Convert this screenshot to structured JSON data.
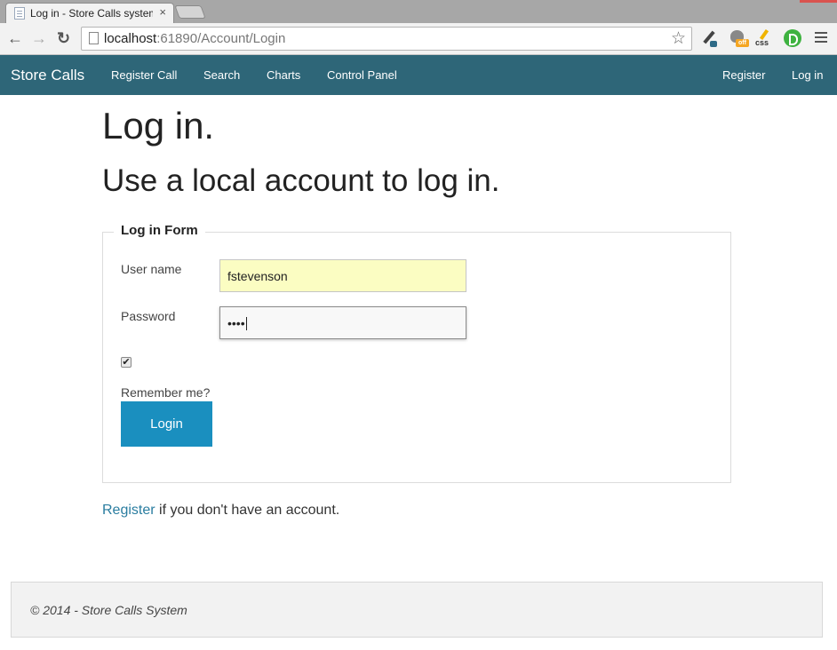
{
  "browser": {
    "tab_title": "Log in - Store Calls system",
    "tab_close": "×",
    "url_host": "localhost",
    "url_rest": ":61890/Account/Login",
    "back": "←",
    "forward": "→",
    "reload": "↻",
    "star": "☆",
    "ext_off_badge": "off",
    "ext_css_label": "css",
    "extensions": [
      "eyedropper-icon",
      "off-cat-icon",
      "css-pencil-icon",
      "ghostery-icon"
    ]
  },
  "navbar": {
    "brand": "Store Calls",
    "links": [
      "Register Call",
      "Search",
      "Charts",
      "Control Panel"
    ],
    "right_links": [
      "Register",
      "Log in"
    ],
    "color": "#2e6678"
  },
  "page": {
    "title": "Log in.",
    "subtitle": "Use a local account to log in."
  },
  "form": {
    "legend": "Log in Form",
    "username_label": "User name",
    "username_value": "fstevenson",
    "password_label": "Password",
    "password_value": "••••",
    "remember_checked": "✔",
    "remember_label": "Remember me?",
    "submit_label": "Login",
    "button_color": "#1a8fbf"
  },
  "footnote": {
    "link": "Register",
    "text": " if you don't have an account."
  },
  "footer": {
    "text": "© 2014 - Store Calls System"
  }
}
